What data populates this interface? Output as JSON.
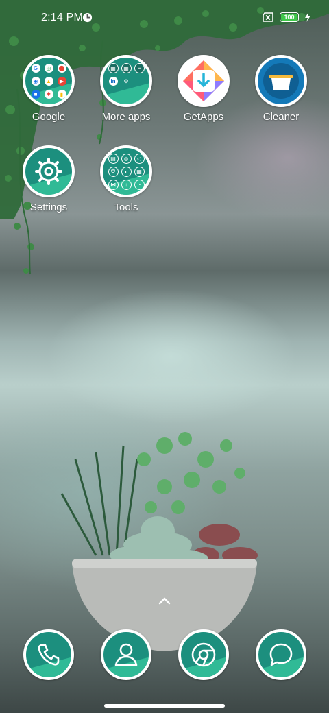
{
  "status_bar": {
    "time": "2:14 PM",
    "battery_level": "100",
    "battery_color": "#3fc84a",
    "icons": [
      "app-notification-icon",
      "no-sim-icon",
      "battery-icon",
      "charging-icon"
    ]
  },
  "home": {
    "apps": [
      {
        "label": "Google",
        "type": "folder"
      },
      {
        "label": "More apps",
        "type": "folder"
      },
      {
        "label": "GetApps",
        "type": "app"
      },
      {
        "label": "Cleaner",
        "type": "app"
      },
      {
        "label": "Settings",
        "type": "app"
      },
      {
        "label": "Tools",
        "type": "folder"
      }
    ]
  },
  "dock": {
    "items": [
      "phone-icon",
      "contacts-icon",
      "chrome-icon",
      "messages-icon"
    ]
  },
  "theme": {
    "icon_teal": "#1c8f7e",
    "icon_accent": "#34c29a"
  }
}
